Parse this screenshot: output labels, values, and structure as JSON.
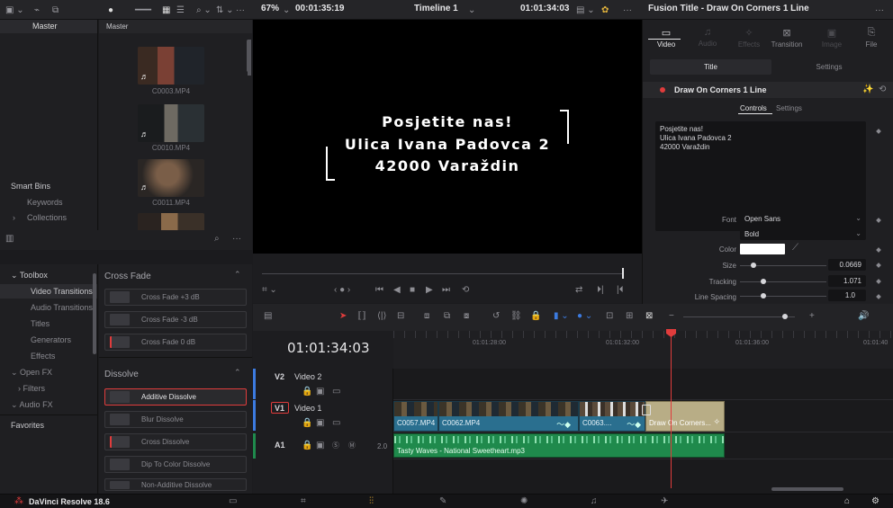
{
  "topbar": {
    "zoom": "67%",
    "source_timecode": "00:01:35:19",
    "timeline_name": "Timeline 1",
    "record_timecode": "01:01:34:03",
    "inspector_title": "Fusion Title - Draw On Corners 1 Line"
  },
  "sidebar": {
    "master": "Master",
    "smart_bins": "Smart Bins",
    "keywords": "Keywords",
    "collections": "Collections"
  },
  "media_pool": {
    "header": "Master",
    "clips": [
      "C0003.MP4",
      "C0010.MP4",
      "C0011.MP4"
    ]
  },
  "effects": {
    "tree": [
      {
        "label": "Toolbox",
        "type": "head"
      },
      {
        "label": "Video Transitions",
        "type": "item"
      },
      {
        "label": "Audio Transitions",
        "type": "item"
      },
      {
        "label": "Titles",
        "type": "item"
      },
      {
        "label": "Generators",
        "type": "item"
      },
      {
        "label": "Effects",
        "type": "item"
      },
      {
        "label": "Open FX",
        "type": "head"
      },
      {
        "label": "Filters",
        "type": "sub"
      },
      {
        "label": "Audio FX",
        "type": "head"
      }
    ],
    "favorites": "Favorites",
    "cross_fade_section": "Cross Fade",
    "cross_fades": [
      "Cross Fade +3 dB",
      "Cross Fade -3 dB",
      "Cross Fade 0 dB"
    ],
    "dissolve_section": "Dissolve",
    "dissolves": [
      "Additive Dissolve",
      "Blur Dissolve",
      "Cross Dissolve",
      "Dip To Color Dissolve",
      "Non-Additive Dissolve"
    ]
  },
  "viewer": {
    "lines": [
      "Posjetite nas!",
      "Ulica Ivana Padovca 2",
      "42000 Varaždin"
    ]
  },
  "inspector": {
    "tabs": [
      {
        "label": "Video",
        "icon": "▭",
        "enabled": true
      },
      {
        "label": "Audio",
        "icon": "♫",
        "enabled": false
      },
      {
        "label": "Effects",
        "icon": "✧",
        "enabled": false
      },
      {
        "label": "Transition",
        "icon": "⊠",
        "enabled": true
      },
      {
        "label": "Image",
        "icon": "▣",
        "enabled": false
      },
      {
        "label": "File",
        "icon": "⎘",
        "enabled": true
      }
    ],
    "subtabs": [
      "Title",
      "Settings"
    ],
    "node_title": "Draw On Corners 1 Line",
    "node_tabs": [
      "Controls",
      "Settings"
    ],
    "text_value": "Posjetite nas!\nUlica Ivana Padovca 2\n42000 Varaždin",
    "font_label": "Font",
    "font_value": "Open Sans",
    "style_value": "Bold",
    "color_label": "Color",
    "size_label": "Size",
    "size_value": "0.0669",
    "tracking_label": "Tracking",
    "tracking_value": "1.071",
    "line_spacing_label": "Line Spacing",
    "line_spacing_value": "1.0"
  },
  "timeline": {
    "timecode": "01:01:34:03",
    "ruler_marks": [
      "01:01:28:00",
      "01:01:32:00",
      "01:01:36:00",
      "01:01:40"
    ],
    "tracks": [
      {
        "id": "V2",
        "name": "Video 2"
      },
      {
        "id": "V1",
        "name": "Video 1"
      },
      {
        "id": "A1",
        "name": "",
        "vol": "2.0"
      }
    ],
    "clips_v1": [
      "C0057.MP4",
      "C0062.MP4",
      "C0063....",
      "Draw On Corners..."
    ],
    "audio_clip": "Tasty Waves - National Sweetheart.mp3"
  },
  "app": {
    "name": "DaVinci Resolve 18.6"
  },
  "colors": {
    "accent_red": "#e03c3c",
    "clip_video": "#2a6f8f",
    "clip_audio": "#1f8a4c",
    "clip_title": "#b8ad86"
  }
}
